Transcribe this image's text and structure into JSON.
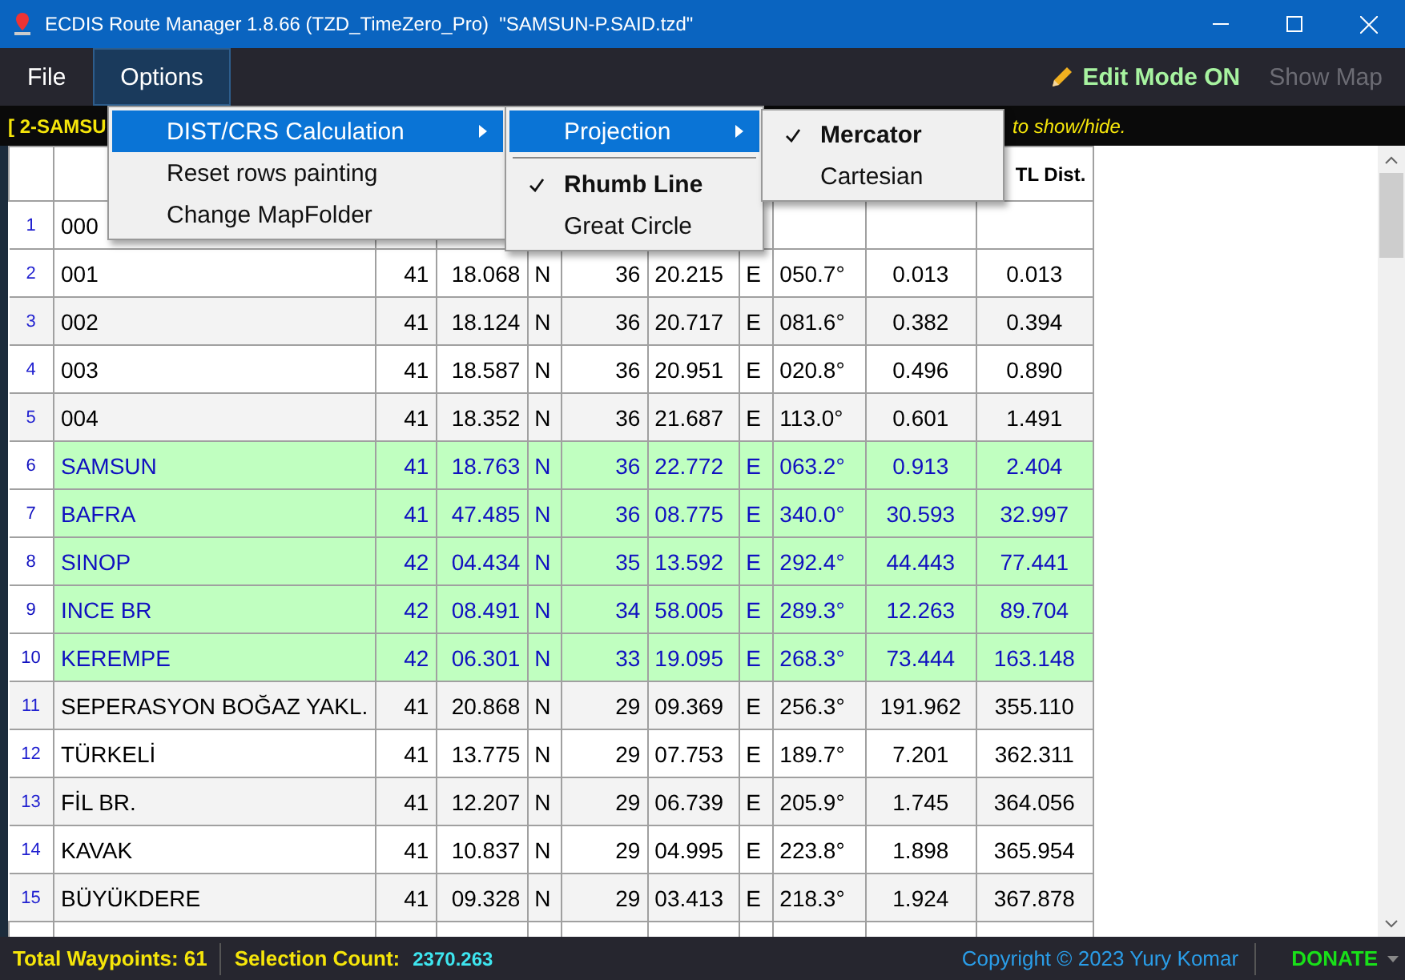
{
  "window": {
    "title": "ECDIS Route Manager 1.8.66 (TZD_TimeZero_Pro)  \"SAMSUN-P.SAID.tzd\""
  },
  "menu_bar": {
    "items": [
      {
        "label": "File",
        "selected": false
      },
      {
        "label": "Options",
        "selected": true
      }
    ],
    "edit_mode": "Edit Mode ON",
    "show_map": {
      "label": "Show Map",
      "disabled": true
    }
  },
  "info_bar": {
    "left": "[ 2-SAMSU",
    "right": "to show/hide."
  },
  "options_menu": {
    "items": [
      {
        "label": "DIST/CRS Calculation",
        "selected": true,
        "submenu": true
      },
      {
        "label": "Reset rows painting",
        "selected": false,
        "submenu": false
      },
      {
        "label": "Change MapFolder",
        "selected": false,
        "submenu": false
      }
    ]
  },
  "calc_submenu": {
    "items": [
      {
        "label": "Projection",
        "selected": true,
        "checked": false,
        "submenu": true
      },
      {
        "kind": "separator"
      },
      {
        "label": "Rhumb Line",
        "selected": false,
        "checked": true,
        "submenu": false
      },
      {
        "label": "Great Circle",
        "selected": false,
        "checked": false,
        "submenu": false
      }
    ]
  },
  "projection_submenu": {
    "items": [
      {
        "label": "Mercator",
        "checked": true
      },
      {
        "label": "Cartesian",
        "checked": false
      }
    ]
  },
  "table": {
    "header": {
      "column_11": "TL Dist."
    },
    "rows": [
      {
        "num": "1",
        "name": "000",
        "highlighted": false
      },
      {
        "num": "2",
        "name": "001",
        "lat_deg": "41",
        "lat_min": "18.068",
        "ns": "N",
        "lon_deg": "36",
        "lon_min": "20.215",
        "ew": "E",
        "course": "050.7°",
        "dist": "0.013",
        "total": "0.013",
        "highlighted": false
      },
      {
        "num": "3",
        "name": "002",
        "lat_deg": "41",
        "lat_min": "18.124",
        "ns": "N",
        "lon_deg": "36",
        "lon_min": "20.717",
        "ew": "E",
        "course": "081.6°",
        "dist": "0.382",
        "total": "0.394",
        "highlighted": false
      },
      {
        "num": "4",
        "name": "003",
        "lat_deg": "41",
        "lat_min": "18.587",
        "ns": "N",
        "lon_deg": "36",
        "lon_min": "20.951",
        "ew": "E",
        "course": "020.8°",
        "dist": "0.496",
        "total": "0.890",
        "highlighted": false
      },
      {
        "num": "5",
        "name": "004",
        "lat_deg": "41",
        "lat_min": "18.352",
        "ns": "N",
        "lon_deg": "36",
        "lon_min": "21.687",
        "ew": "E",
        "course": "113.0°",
        "dist": "0.601",
        "total": "1.491",
        "highlighted": false
      },
      {
        "num": "6",
        "name": "SAMSUN",
        "lat_deg": "41",
        "lat_min": "18.763",
        "ns": "N",
        "lon_deg": "36",
        "lon_min": "22.772",
        "ew": "E",
        "course": "063.2°",
        "dist": "0.913",
        "total": "2.404",
        "highlighted": true
      },
      {
        "num": "7",
        "name": "BAFRA",
        "lat_deg": "41",
        "lat_min": "47.485",
        "ns": "N",
        "lon_deg": "36",
        "lon_min": "08.775",
        "ew": "E",
        "course": "340.0°",
        "dist": "30.593",
        "total": "32.997",
        "highlighted": true
      },
      {
        "num": "8",
        "name": "SINOP",
        "lat_deg": "42",
        "lat_min": "04.434",
        "ns": "N",
        "lon_deg": "35",
        "lon_min": "13.592",
        "ew": "E",
        "course": "292.4°",
        "dist": "44.443",
        "total": "77.441",
        "highlighted": true
      },
      {
        "num": "9",
        "name": "INCE BR",
        "lat_deg": "42",
        "lat_min": "08.491",
        "ns": "N",
        "lon_deg": "34",
        "lon_min": "58.005",
        "ew": "E",
        "course": "289.3°",
        "dist": "12.263",
        "total": "89.704",
        "highlighted": true
      },
      {
        "num": "10",
        "name": "KEREMPE",
        "lat_deg": "42",
        "lat_min": "06.301",
        "ns": "N",
        "lon_deg": "33",
        "lon_min": "19.095",
        "ew": "E",
        "course": "268.3°",
        "dist": "73.444",
        "total": "163.148",
        "highlighted": true
      },
      {
        "num": "11",
        "name": "SEPERASYON BOĞAZ YAKL.",
        "lat_deg": "41",
        "lat_min": "20.868",
        "ns": "N",
        "lon_deg": "29",
        "lon_min": "09.369",
        "ew": "E",
        "course": "256.3°",
        "dist": "191.962",
        "total": "355.110",
        "highlighted": false
      },
      {
        "num": "12",
        "name": "TÜRKELİ",
        "lat_deg": "41",
        "lat_min": "13.775",
        "ns": "N",
        "lon_deg": "29",
        "lon_min": "07.753",
        "ew": "E",
        "course": "189.7°",
        "dist": "7.201",
        "total": "362.311",
        "highlighted": false
      },
      {
        "num": "13",
        "name": "FİL BR.",
        "lat_deg": "41",
        "lat_min": "12.207",
        "ns": "N",
        "lon_deg": "29",
        "lon_min": "06.739",
        "ew": "E",
        "course": "205.9°",
        "dist": "1.745",
        "total": "364.056",
        "highlighted": false
      },
      {
        "num": "14",
        "name": "KAVAK",
        "lat_deg": "41",
        "lat_min": "10.837",
        "ns": "N",
        "lon_deg": "29",
        "lon_min": "04.995",
        "ew": "E",
        "course": "223.8°",
        "dist": "1.898",
        "total": "365.954",
        "highlighted": false
      },
      {
        "num": "15",
        "name": "BÜYÜKDERE",
        "lat_deg": "41",
        "lat_min": "09.328",
        "ns": "N",
        "lon_deg": "29",
        "lon_min": "03.413",
        "ew": "E",
        "course": "218.3°",
        "dist": "1.924",
        "total": "367.878",
        "highlighted": false
      }
    ]
  },
  "status_bar": {
    "total_waypoints": "Total Waypoints: 61",
    "selection_label": "Selection Count:",
    "selection_value": "2370.263",
    "copyright": "Copyright © 2023 Yury Komar",
    "donate": "DONATE"
  }
}
